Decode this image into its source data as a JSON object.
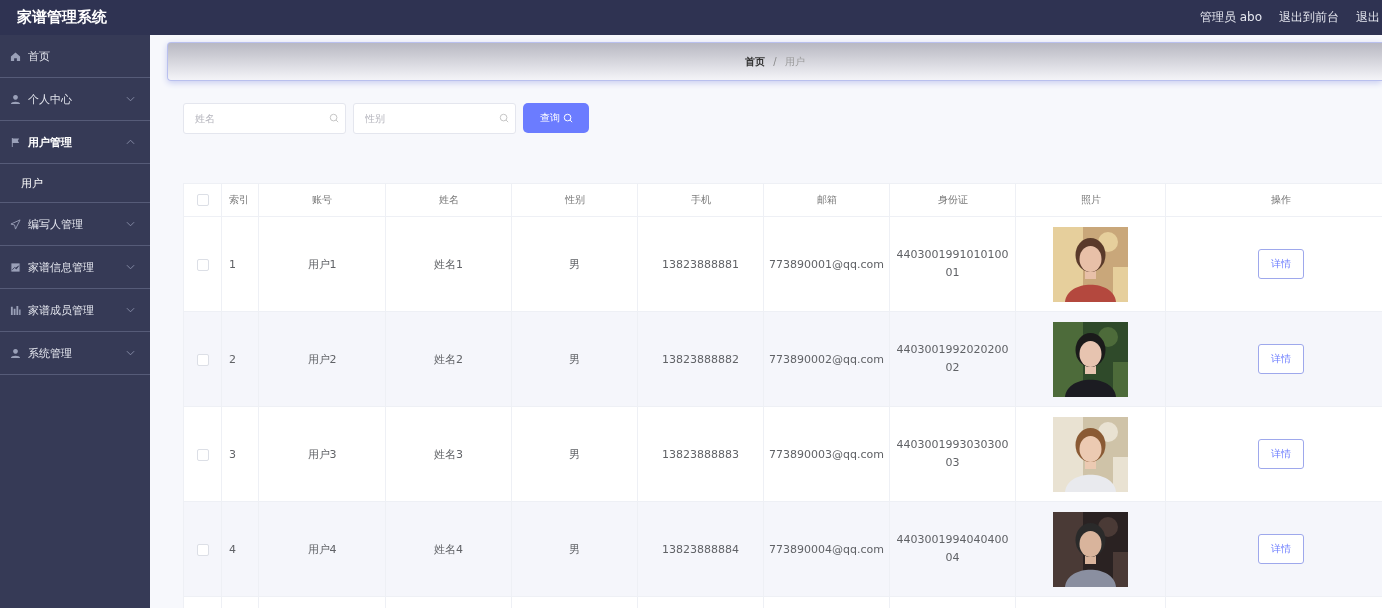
{
  "header": {
    "title": "家谱管理系统",
    "user": "管理员 abo",
    "links": [
      "退出到前台",
      "退出"
    ]
  },
  "sidebar": {
    "items": [
      {
        "label": "首页",
        "kind": "link"
      },
      {
        "label": "个人中心",
        "kind": "menu",
        "expanded": false
      },
      {
        "label": "用户管理",
        "kind": "menu",
        "expanded": true,
        "children": [
          {
            "label": "用户"
          }
        ]
      },
      {
        "label": "编写人管理",
        "kind": "menu",
        "expanded": false
      },
      {
        "label": "家谱信息管理",
        "kind": "menu",
        "expanded": false
      },
      {
        "label": "家谱成员管理",
        "kind": "menu",
        "expanded": false
      },
      {
        "label": "系统管理",
        "kind": "menu",
        "expanded": false
      }
    ]
  },
  "breadcrumb": {
    "separator": "/",
    "items": [
      "首页",
      "用户"
    ]
  },
  "search": {
    "fields": [
      {
        "placeholder": "姓名"
      },
      {
        "placeholder": "性别"
      }
    ],
    "button": "查询"
  },
  "table": {
    "header_checked": false,
    "columns": [
      "索引",
      "账号",
      "姓名",
      "性别",
      "手机",
      "邮箱",
      "身份证",
      "照片",
      "操作"
    ],
    "rows": [
      {
        "checked": false,
        "index": "1",
        "account": "用户1",
        "name": "姓名1",
        "gender": "男",
        "phone": "13823888881",
        "email": "773890001@qq.com",
        "id_card": "440300199101010001",
        "action": "详情"
      },
      {
        "checked": false,
        "index": "2",
        "account": "用户2",
        "name": "姓名2",
        "gender": "男",
        "phone": "13823888882",
        "email": "773890002@qq.com",
        "id_card": "440300199202020002",
        "action": "详情"
      },
      {
        "checked": false,
        "index": "3",
        "account": "用户3",
        "name": "姓名3",
        "gender": "男",
        "phone": "13823888883",
        "email": "773890003@qq.com",
        "id_card": "440300199303030003",
        "action": "详情"
      },
      {
        "checked": false,
        "index": "4",
        "account": "用户4",
        "name": "姓名4",
        "gender": "男",
        "phone": "13823888884",
        "email": "773890004@qq.com",
        "id_card": "440300199404040004",
        "action": "详情"
      }
    ]
  }
}
